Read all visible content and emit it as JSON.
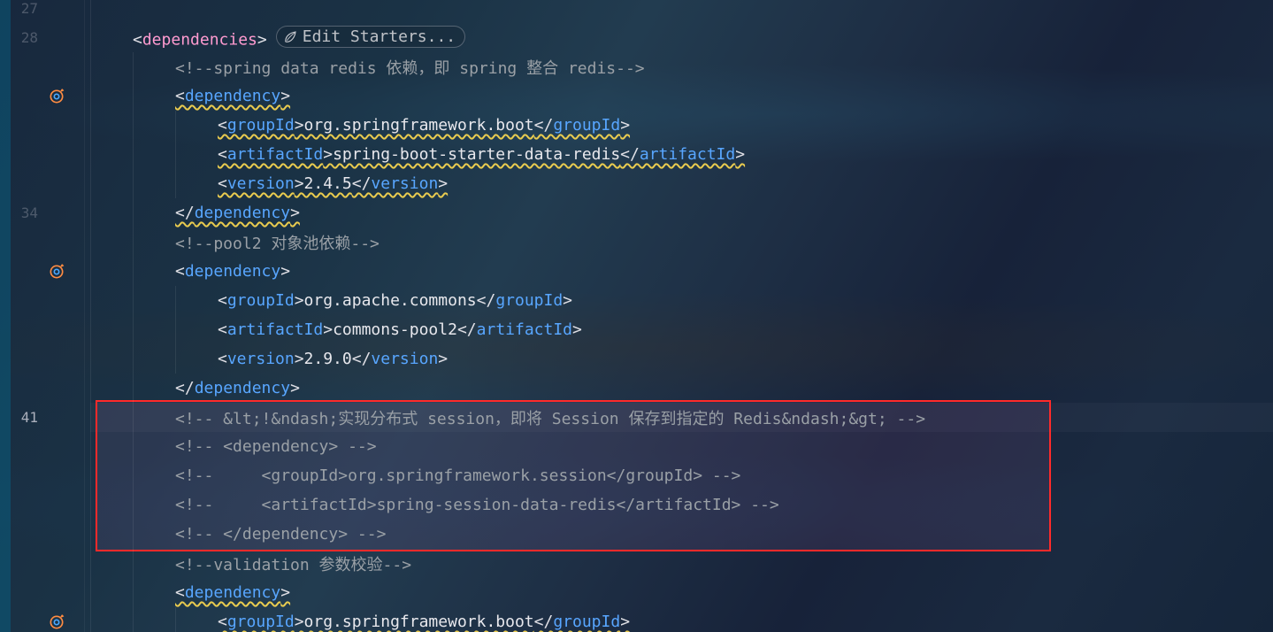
{
  "line_numbers": [
    "27",
    "28",
    "",
    "",
    "",
    "",
    "",
    "34",
    "",
    "",
    "",
    "",
    "",
    "",
    "41",
    "",
    "",
    "",
    "",
    "",
    "",
    ""
  ],
  "current_line_idx": 14,
  "bp_icon_rows": [
    3,
    9,
    21
  ],
  "edit_starters_label": "Edit Starters...",
  "highlight_box": {
    "top_row": 14,
    "bottom_row": 18
  },
  "code": {
    "lines": [
      {
        "indent": 1,
        "parts": []
      },
      {
        "indent": 1,
        "parts": [
          {
            "t": "br",
            "v": "<"
          },
          {
            "t": "tag-pink",
            "v": "dependencies"
          },
          {
            "t": "br",
            "v": ">"
          },
          {
            "t": "pill"
          }
        ]
      },
      {
        "indent": 2,
        "parts": [
          {
            "t": "comment",
            "v": "<!--spring data redis 依赖，即 spring 整合 redis-->"
          }
        ]
      },
      {
        "indent": 2,
        "wavy": true,
        "parts": [
          {
            "t": "br",
            "v": "<"
          },
          {
            "t": "tag",
            "v": "dependency"
          },
          {
            "t": "br",
            "v": ">"
          }
        ]
      },
      {
        "indent": 3,
        "wavy": true,
        "parts": [
          {
            "t": "br",
            "v": "<"
          },
          {
            "t": "tag",
            "v": "groupId"
          },
          {
            "t": "br",
            "v": ">"
          },
          {
            "t": "txt",
            "v": "org.springframework.boot"
          },
          {
            "t": "br",
            "v": "</"
          },
          {
            "t": "tag",
            "v": "groupId"
          },
          {
            "t": "br",
            "v": ">"
          }
        ]
      },
      {
        "indent": 3,
        "wavy": true,
        "parts": [
          {
            "t": "br",
            "v": "<"
          },
          {
            "t": "tag",
            "v": "artifactId"
          },
          {
            "t": "br",
            "v": ">"
          },
          {
            "t": "txt",
            "v": "spring-boot-starter-data-redis"
          },
          {
            "t": "br",
            "v": "</"
          },
          {
            "t": "tag",
            "v": "artifactId"
          },
          {
            "t": "br",
            "v": ">"
          }
        ]
      },
      {
        "indent": 3,
        "wavy": true,
        "parts": [
          {
            "t": "br",
            "v": "<"
          },
          {
            "t": "tag",
            "v": "version"
          },
          {
            "t": "br",
            "v": ">"
          },
          {
            "t": "txt",
            "v": "2.4.5"
          },
          {
            "t": "br",
            "v": "</"
          },
          {
            "t": "tag",
            "v": "version"
          },
          {
            "t": "br",
            "v": ">"
          }
        ]
      },
      {
        "indent": 2,
        "wavy": true,
        "parts": [
          {
            "t": "br",
            "v": "</"
          },
          {
            "t": "tag",
            "v": "dependency"
          },
          {
            "t": "br",
            "v": ">"
          }
        ]
      },
      {
        "indent": 2,
        "parts": [
          {
            "t": "comment",
            "v": "<!--pool2 对象池依赖-->"
          }
        ]
      },
      {
        "indent": 2,
        "parts": [
          {
            "t": "br",
            "v": "<"
          },
          {
            "t": "tag",
            "v": "dependency"
          },
          {
            "t": "br",
            "v": ">"
          }
        ]
      },
      {
        "indent": 3,
        "parts": [
          {
            "t": "br",
            "v": "<"
          },
          {
            "t": "tag",
            "v": "groupId"
          },
          {
            "t": "br",
            "v": ">"
          },
          {
            "t": "txt",
            "v": "org.apache.commons"
          },
          {
            "t": "br",
            "v": "</"
          },
          {
            "t": "tag",
            "v": "groupId"
          },
          {
            "t": "br",
            "v": ">"
          }
        ]
      },
      {
        "indent": 3,
        "parts": [
          {
            "t": "br",
            "v": "<"
          },
          {
            "t": "tag",
            "v": "artifactId"
          },
          {
            "t": "br",
            "v": ">"
          },
          {
            "t": "txt",
            "v": "commons-pool2"
          },
          {
            "t": "br",
            "v": "</"
          },
          {
            "t": "tag",
            "v": "artifactId"
          },
          {
            "t": "br",
            "v": ">"
          }
        ]
      },
      {
        "indent": 3,
        "parts": [
          {
            "t": "br",
            "v": "<"
          },
          {
            "t": "tag",
            "v": "version"
          },
          {
            "t": "br",
            "v": ">"
          },
          {
            "t": "txt",
            "v": "2.9.0"
          },
          {
            "t": "br",
            "v": "</"
          },
          {
            "t": "tag",
            "v": "version"
          },
          {
            "t": "br",
            "v": ">"
          }
        ]
      },
      {
        "indent": 2,
        "parts": [
          {
            "t": "br",
            "v": "</"
          },
          {
            "t": "tag",
            "v": "dependency"
          },
          {
            "t": "br",
            "v": ">"
          }
        ]
      },
      {
        "indent": 2,
        "parts": [
          {
            "t": "comment",
            "v": "<!-- &lt;!&ndash;实现分布式 session，即将 Session 保存到指定的 Redis&ndash;&gt; -->"
          }
        ]
      },
      {
        "indent": 2,
        "parts": [
          {
            "t": "comment",
            "v": "<!-- <dependency> -->"
          }
        ]
      },
      {
        "indent": 2,
        "parts": [
          {
            "t": "comment",
            "v": "<!--     <groupId>org.springframework.session</groupId> -->"
          }
        ]
      },
      {
        "indent": 2,
        "parts": [
          {
            "t": "comment",
            "v": "<!--     <artifactId>spring-session-data-redis</artifactId> -->"
          }
        ]
      },
      {
        "indent": 2,
        "parts": [
          {
            "t": "comment",
            "v": "<!-- </dependency> -->"
          }
        ]
      },
      {
        "indent": 2,
        "parts": [
          {
            "t": "comment",
            "v": "<!--validation 参数校验-->"
          }
        ]
      },
      {
        "indent": 2,
        "wavy": true,
        "parts": [
          {
            "t": "br",
            "v": "<"
          },
          {
            "t": "tag",
            "v": "dependency"
          },
          {
            "t": "br",
            "v": ">"
          }
        ]
      },
      {
        "indent": 3,
        "wavy": true,
        "parts": [
          {
            "t": "br",
            "v": "<"
          },
          {
            "t": "tag",
            "v": "groupId"
          },
          {
            "t": "br",
            "v": ">"
          },
          {
            "t": "txt",
            "v": "org.springframework.boot"
          },
          {
            "t": "br",
            "v": "</"
          },
          {
            "t": "tag",
            "v": "groupId"
          },
          {
            "t": "br",
            "v": ">"
          }
        ]
      }
    ]
  }
}
